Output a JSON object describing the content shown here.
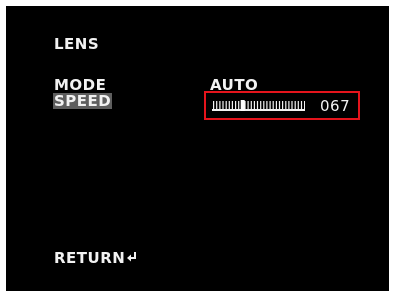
{
  "menu": {
    "title": "LENS",
    "items": [
      {
        "label": "MODE",
        "value": "AUTO"
      },
      {
        "label": "SPEED",
        "value": "067",
        "level_percent": 33,
        "selected": true
      }
    ],
    "return_label": "RETURN",
    "return_icon": "return-arrow-icon"
  },
  "colors": {
    "background": "#000000",
    "text": "#f2f2f2",
    "highlight": "#5e5e5e",
    "focus_box": "#e5141c"
  }
}
